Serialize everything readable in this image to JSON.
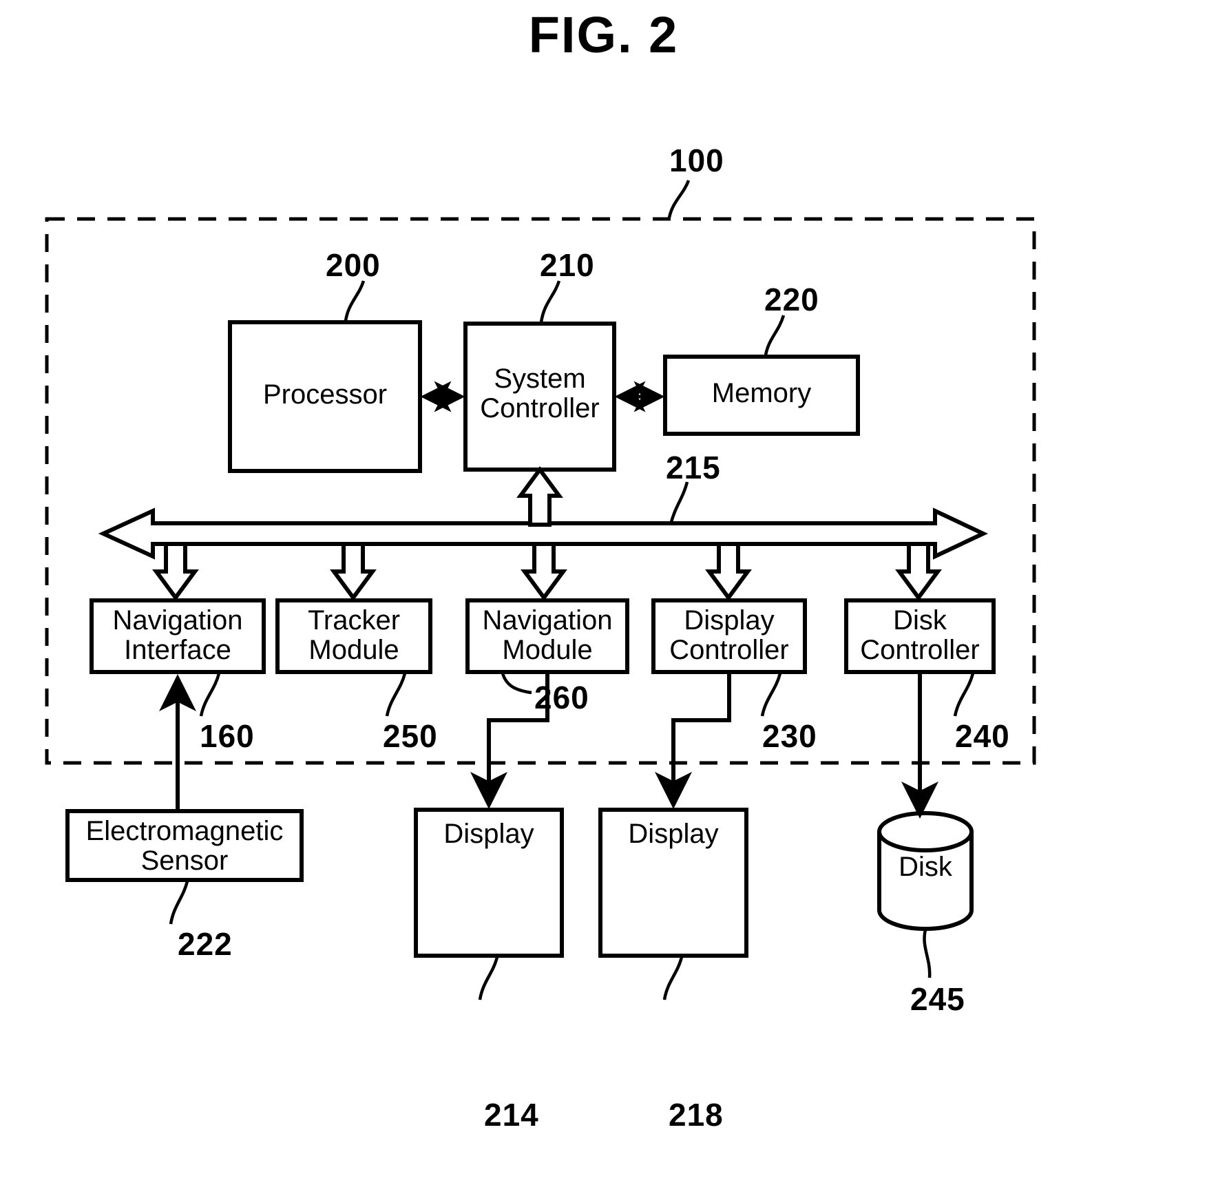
{
  "figure": {
    "title": "FIG. 2",
    "enclosure_label": "100",
    "enclosure_style": "dashed"
  },
  "blocks": [
    {
      "id": "processor",
      "label": "Processor",
      "ref": "200",
      "shape": "rect"
    },
    {
      "id": "system-controller",
      "label": "System\nController",
      "ref": "210",
      "shape": "rect"
    },
    {
      "id": "memory",
      "label": "Memory",
      "ref": "220",
      "shape": "rect"
    },
    {
      "id": "navigation-interface",
      "label": "Navigation\nInterface",
      "ref": "160",
      "shape": "rect"
    },
    {
      "id": "tracker-module",
      "label": "Tracker\nModule",
      "ref": "250",
      "shape": "rect"
    },
    {
      "id": "navigation-module",
      "label": "Navigation\nModule",
      "ref": "260",
      "shape": "rect"
    },
    {
      "id": "display-controller",
      "label": "Display\nController",
      "ref": "230",
      "shape": "rect"
    },
    {
      "id": "disk-controller",
      "label": "Disk\nController",
      "ref": "240",
      "shape": "rect"
    },
    {
      "id": "electromagnetic-sensor",
      "label": "Electromagnetic\nSensor",
      "ref": "222",
      "shape": "rect"
    },
    {
      "id": "display-214",
      "label": "Display",
      "ref": "214",
      "shape": "rect"
    },
    {
      "id": "display-218",
      "label": "Display",
      "ref": "218",
      "shape": "rect"
    },
    {
      "id": "disk",
      "label": "Disk",
      "ref": "245",
      "shape": "cylinder"
    }
  ],
  "bus": {
    "id": "system-bus",
    "ref": "215",
    "style": "hollow-double-arrow"
  },
  "connections": [
    {
      "from": "processor",
      "to": "system-controller",
      "style": "double-arrow"
    },
    {
      "from": "system-controller",
      "to": "memory",
      "style": "double-arrow"
    },
    {
      "from": "system-controller",
      "to": "system-bus",
      "style": "hollow-arrow"
    },
    {
      "from": "system-bus",
      "to": "navigation-interface",
      "style": "hollow-arrow"
    },
    {
      "from": "system-bus",
      "to": "tracker-module",
      "style": "hollow-arrow"
    },
    {
      "from": "system-bus",
      "to": "navigation-module",
      "style": "hollow-arrow"
    },
    {
      "from": "system-bus",
      "to": "display-controller",
      "style": "hollow-arrow"
    },
    {
      "from": "system-bus",
      "to": "disk-controller",
      "style": "hollow-arrow"
    },
    {
      "from": "electromagnetic-sensor",
      "to": "navigation-interface",
      "style": "arrow"
    },
    {
      "from": "navigation-module",
      "to": "display-214",
      "style": "arrow"
    },
    {
      "from": "display-controller",
      "to": "display-218",
      "style": "arrow"
    },
    {
      "from": "disk-controller",
      "to": "disk",
      "style": "arrow"
    }
  ],
  "ref_numbers": {
    "enclosure": "100",
    "processor": "200",
    "system_controller": "210",
    "memory": "220",
    "bus": "215",
    "navigation_interface": "160",
    "tracker_module": "250",
    "navigation_module": "260",
    "display_controller": "230",
    "disk_controller": "240",
    "electromagnetic_sensor": "222",
    "display_a": "214",
    "display_b": "218",
    "disk": "245"
  }
}
